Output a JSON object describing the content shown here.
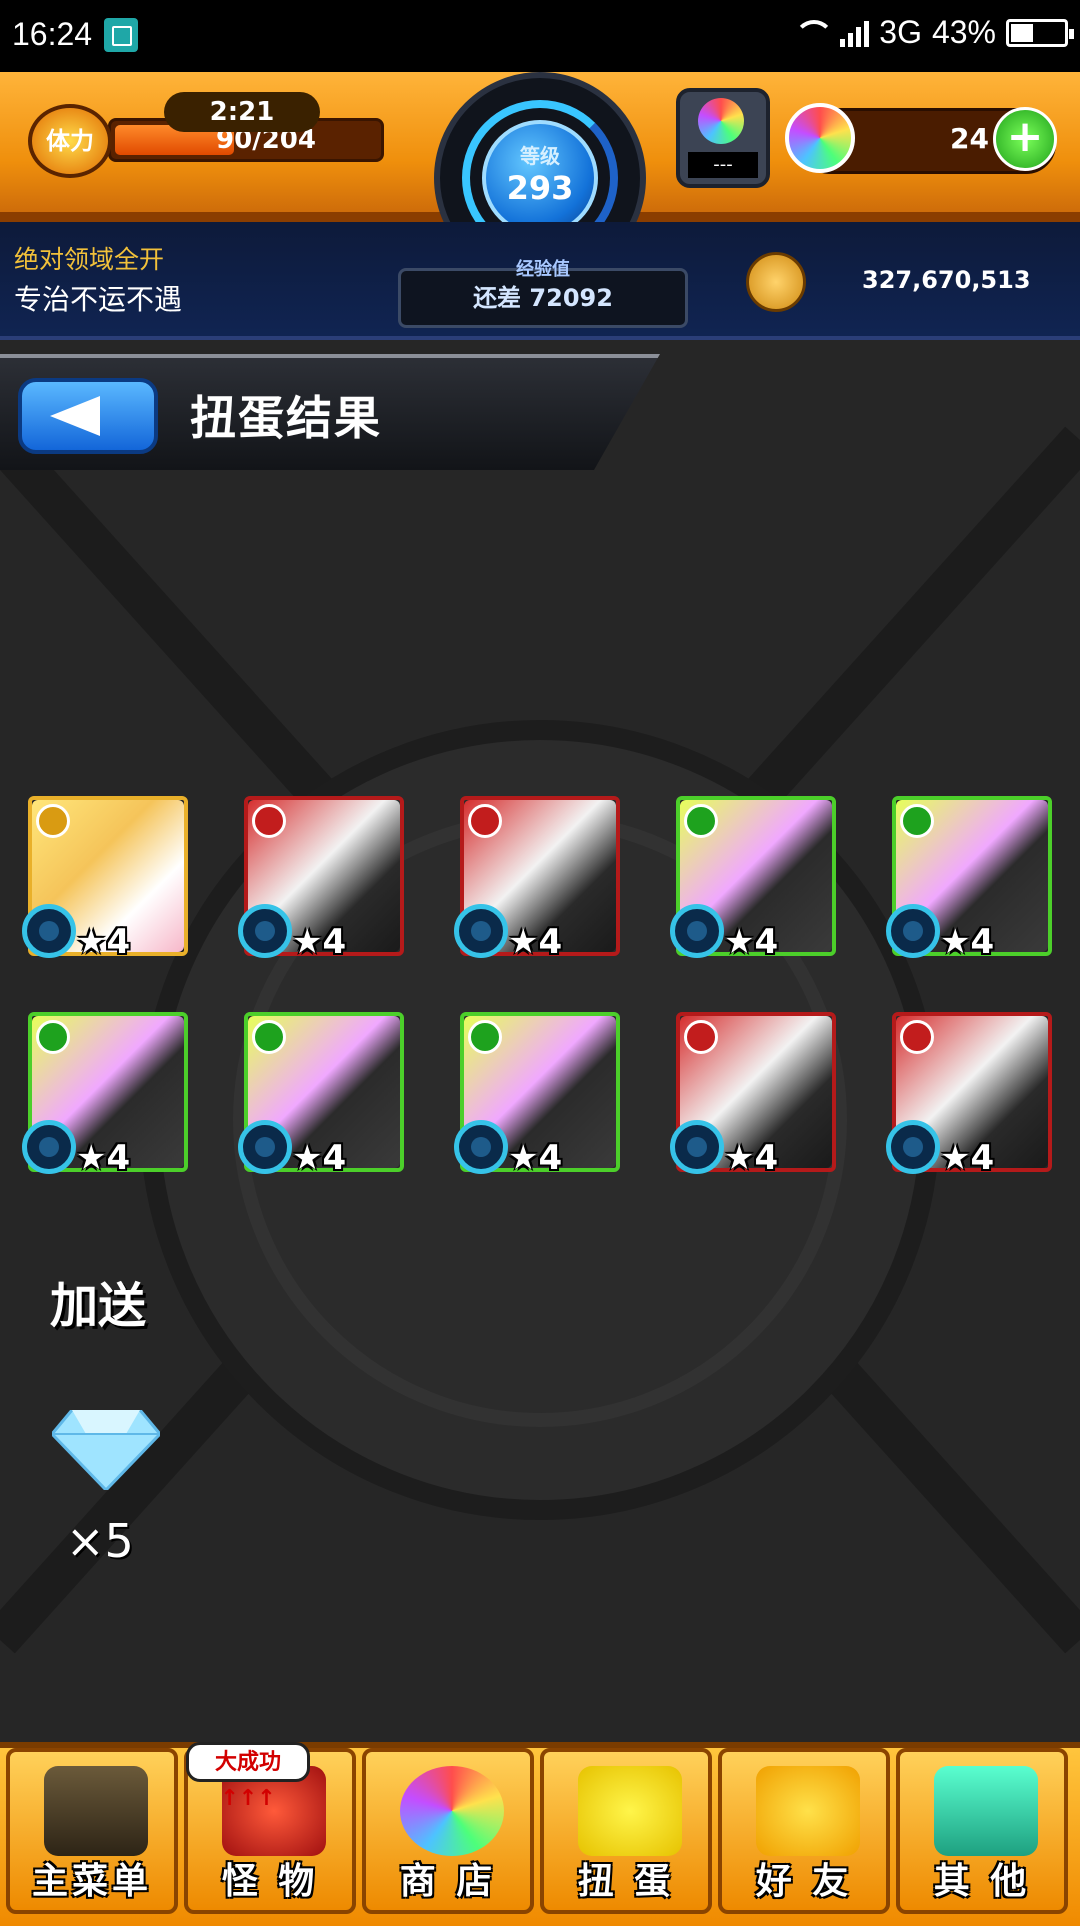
{
  "status_bar": {
    "time": "16:24",
    "network": "3G",
    "battery": "43%",
    "battery_level": 0.43
  },
  "player": {
    "stamina_label": "体力",
    "stamina_timer": "2:21",
    "stamina": "90/204",
    "stamina_fraction": 0.44,
    "level_label": "等级",
    "level": "293",
    "exp_label": "经验值",
    "exp_remaining": "还差 72092",
    "gacha_counter": "---",
    "orbs": "24",
    "title_line1": "绝对领域全开",
    "title_line2": "专治不运不遇",
    "gold": "327,670,513"
  },
  "header": {
    "title": "扭蛋结果"
  },
  "results": [
    {
      "border": "gold",
      "stars": "★4",
      "icon": "character-blonde-girl"
    },
    {
      "border": "red",
      "stars": "★4",
      "icon": "character-red-hair-warrior"
    },
    {
      "border": "red",
      "stars": "★4",
      "icon": "character-red-hair-warrior"
    },
    {
      "border": "green",
      "stars": "★4",
      "icon": "character-black-cat"
    },
    {
      "border": "green",
      "stars": "★4",
      "icon": "character-black-cat"
    },
    {
      "border": "green",
      "stars": "★4",
      "icon": "character-black-cat"
    },
    {
      "border": "green",
      "stars": "★4",
      "icon": "character-black-cat"
    },
    {
      "border": "green",
      "stars": "★4",
      "icon": "character-black-cat"
    },
    {
      "border": "red",
      "stars": "★4",
      "icon": "character-brown-hair-girl"
    },
    {
      "border": "red",
      "stars": "★4",
      "icon": "character-red-hair-warrior"
    }
  ],
  "bonus": {
    "title": "加送",
    "item_icon": "diamond-icon",
    "count": "×5"
  },
  "nav": {
    "promo": "大成功↑↑↑",
    "items": [
      {
        "label": "主菜单",
        "icon": "gate-icon"
      },
      {
        "label": "怪 物",
        "icon": "monster-icon"
      },
      {
        "label": "商 店",
        "icon": "orb-icon"
      },
      {
        "label": "扭 蛋",
        "icon": "egg-icon"
      },
      {
        "label": "好 友",
        "icon": "friends-icon"
      },
      {
        "label": "其 他",
        "icon": "question-icon"
      }
    ]
  },
  "colors": {
    "gold": "#e9b02a",
    "red": "#b51a1a",
    "green": "#4ccf2a",
    "accent": "#f08a00"
  }
}
